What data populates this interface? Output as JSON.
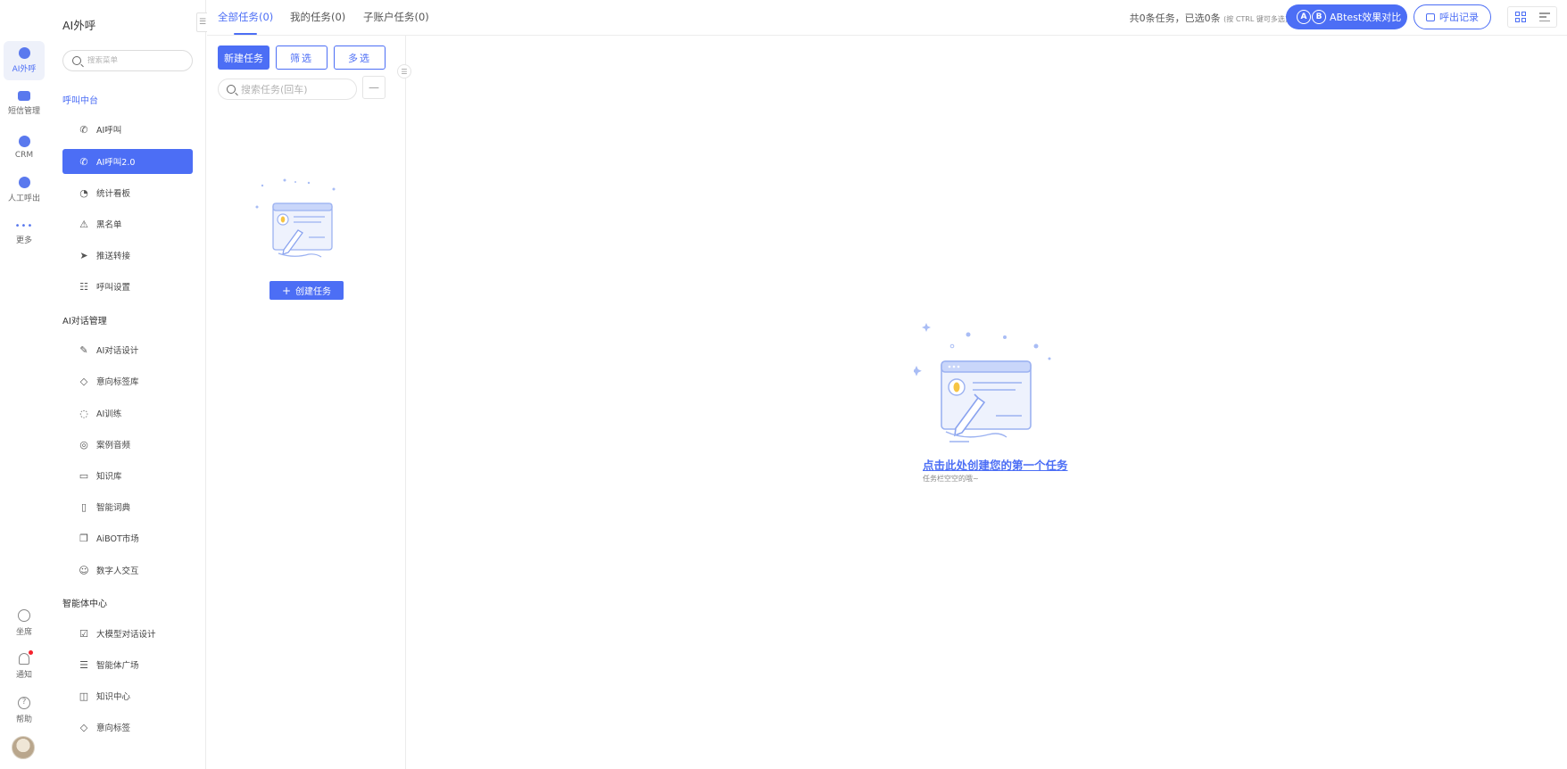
{
  "rail": {
    "items": [
      {
        "label": "AI外呼",
        "icon": "robot-icon"
      },
      {
        "label": "短信管理",
        "icon": "message-icon"
      },
      {
        "label": "CRM",
        "icon": "crm-icon"
      },
      {
        "label": "人工呼出",
        "icon": "agent-icon"
      },
      {
        "label": "更多",
        "icon": "more-icon"
      }
    ],
    "bottom": [
      {
        "label": "坐席",
        "icon": "headset-icon"
      },
      {
        "label": "通知",
        "icon": "bell-icon"
      },
      {
        "label": "帮助",
        "icon": "help-icon"
      }
    ]
  },
  "menu": {
    "title": "AI外呼",
    "search_placeholder": "搜索菜单",
    "groups": [
      {
        "title": "呼叫中台",
        "items": [
          {
            "label": "AI呼叫",
            "icon": "phone-icon"
          },
          {
            "label": "AI呼叫2.0",
            "icon": "phone-wave-icon",
            "active": true
          },
          {
            "label": "统计看板",
            "icon": "pie-chart-icon"
          },
          {
            "label": "黑名单",
            "icon": "warning-icon"
          },
          {
            "label": "推送转接",
            "icon": "send-icon"
          },
          {
            "label": "呼叫设置",
            "icon": "sliders-icon"
          }
        ]
      },
      {
        "title": "AI对话管理",
        "items": [
          {
            "label": "AI对话设计",
            "icon": "pen-icon"
          },
          {
            "label": "意向标签库",
            "icon": "tag-icon"
          },
          {
            "label": "AI训练",
            "icon": "chat-icon"
          },
          {
            "label": "案例音频",
            "icon": "voicemail-icon"
          },
          {
            "label": "知识库",
            "icon": "laptop-icon"
          },
          {
            "label": "智能词典",
            "icon": "book-icon"
          },
          {
            "label": "AiBOT市场",
            "icon": "window-icon"
          },
          {
            "label": "数字人交互",
            "icon": "digital-human-icon"
          }
        ]
      },
      {
        "title": "智能体中心",
        "items": [
          {
            "label": "大模型对话设计",
            "icon": "checkbox-icon"
          },
          {
            "label": "智能体广场",
            "icon": "store-icon"
          },
          {
            "label": "知识中心",
            "icon": "open-book-icon"
          },
          {
            "label": "意向标签",
            "icon": "tag-icon"
          }
        ]
      }
    ]
  },
  "tabs": [
    {
      "label": "全部任务(0)",
      "active": true
    },
    {
      "label": "我的任务(0)"
    },
    {
      "label": "子账户任务(0)"
    }
  ],
  "summary": {
    "text": "共0条任务，已选0条",
    "hint": "(按 CTRL 键可多选)"
  },
  "header": {
    "ab_a": "A",
    "ab_b": "B",
    "ab_label": "ABtest效果对比",
    "record_label": "呼出记录"
  },
  "taskpanel": {
    "new_task": "新建任务",
    "filter": "筛选",
    "multi_select": "多选",
    "search_placeholder": "搜索任务(回车)",
    "minus": "—",
    "create_task": "创建任务",
    "create_plus": "+"
  },
  "main": {
    "empty_link": "点击此处创建您的第一个任务",
    "empty_sub": "任务栏空空的哦~"
  },
  "colors": {
    "accent": "#4c6ef5",
    "border": "#ececec",
    "notify_dot": "#f5222d"
  }
}
